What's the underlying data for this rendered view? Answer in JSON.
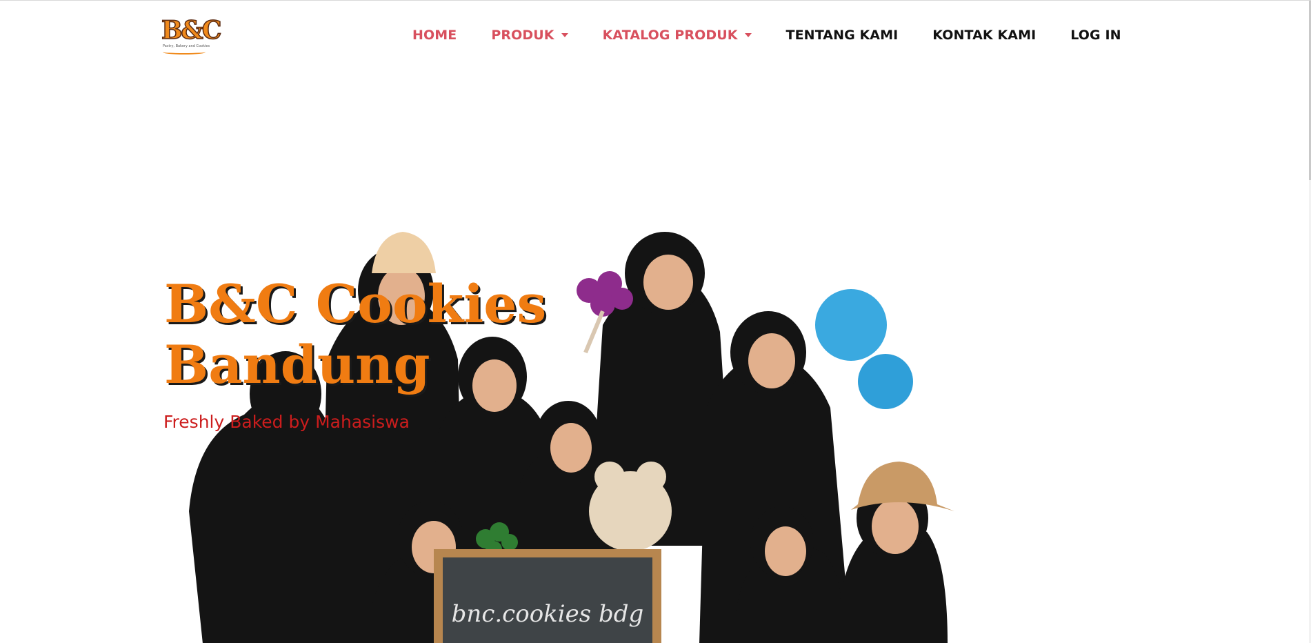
{
  "brand": {
    "logo_text": "B&C",
    "logo_tagline": "Pastry, Bakery and Cookies",
    "accent_color": "#d8505e",
    "orange_color": "#f07c12"
  },
  "nav": {
    "items": [
      {
        "label": "HOME",
        "dropdown": false,
        "accent": true
      },
      {
        "label": "PRODUK",
        "dropdown": true,
        "accent": true
      },
      {
        "label": "KATALOG PRODUK",
        "dropdown": true,
        "accent": true
      },
      {
        "label": "TENTANG KAMI",
        "dropdown": false,
        "accent": false
      },
      {
        "label": "KONTAK KAMI",
        "dropdown": false,
        "accent": false
      },
      {
        "label": "LOG IN",
        "dropdown": false,
        "accent": false
      }
    ]
  },
  "hero": {
    "title": "B&C Cookies\nBandung",
    "subtitle": "Freshly Baked by Mahasiswa",
    "chalkboard_text": "bnc.cookies bdg",
    "photo_icon": "group-photo-icon"
  }
}
